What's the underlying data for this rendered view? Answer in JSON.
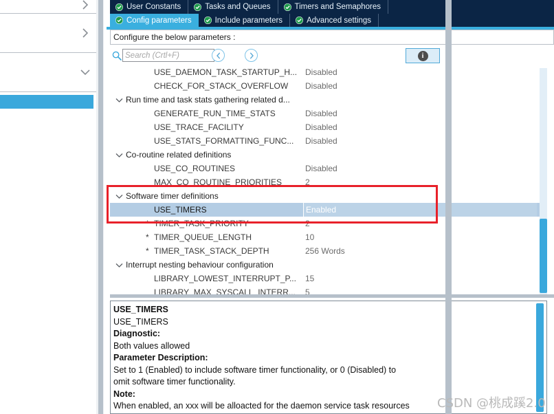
{
  "sidebar": {
    "rows": [
      {
        "chevron": "chevron-right"
      },
      {
        "chevron": "chevron-right"
      },
      {
        "chevron": "chevron-down"
      }
    ],
    "highlight_color": "#3aa8dc"
  },
  "tabs": {
    "row1": [
      {
        "label": "User Constants",
        "icon": "check-circle-icon",
        "active": false
      },
      {
        "label": "Tasks and Queues",
        "icon": "check-circle-icon",
        "active": false
      },
      {
        "label": "Timers and Semaphores",
        "icon": "check-circle-icon",
        "active": false
      }
    ],
    "row2": [
      {
        "label": "Config parameters",
        "icon": "check-circle-icon",
        "active": true
      },
      {
        "label": "Include parameters",
        "icon": "check-circle-icon",
        "active": false
      },
      {
        "label": "Advanced settings",
        "icon": "check-circle-icon",
        "active": false
      }
    ],
    "active_color": "#3aafdf",
    "inactive_color": "#0b2545"
  },
  "config_bar": {
    "label": "Configure the below parameters :"
  },
  "toolbar": {
    "search_placeholder": "Search (Crtl+F)",
    "search_value": "",
    "back_label": "‹",
    "forward_label": "›",
    "info_label": "i"
  },
  "tree": {
    "rows": [
      {
        "type": "param",
        "star": "",
        "name": "USE_DAEMON_TASK_STARTUP_H...",
        "value": "Disabled",
        "selected": false
      },
      {
        "type": "param",
        "star": "",
        "name": "CHECK_FOR_STACK_OVERFLOW",
        "value": "Disabled",
        "selected": false
      },
      {
        "type": "group",
        "label": "Run time and task stats gathering related d...",
        "chevron": "chevron-down"
      },
      {
        "type": "param",
        "star": "",
        "name": "GENERATE_RUN_TIME_STATS",
        "value": "Disabled",
        "selected": false
      },
      {
        "type": "param",
        "star": "",
        "name": "USE_TRACE_FACILITY",
        "value": "Disabled",
        "selected": false
      },
      {
        "type": "param",
        "star": "",
        "name": "USE_STATS_FORMATTING_FUNC...",
        "value": "Disabled",
        "selected": false
      },
      {
        "type": "group",
        "label": "Co-routine related definitions",
        "chevron": "chevron-down"
      },
      {
        "type": "param",
        "star": "",
        "name": "USE_CO_ROUTINES",
        "value": "Disabled",
        "selected": false
      },
      {
        "type": "param",
        "star": "",
        "name": "MAX_CO_ROUTINE_PRIORITIES",
        "value": "2",
        "selected": false
      },
      {
        "type": "group",
        "label": "Software timer definitions",
        "chevron": "chevron-down"
      },
      {
        "type": "param",
        "star": "",
        "name": "USE_TIMERS",
        "value": "Enabled",
        "selected": true
      },
      {
        "type": "param",
        "star": "*",
        "name": "TIMER_TASK_PRIORITY",
        "value": "2",
        "selected": false
      },
      {
        "type": "param",
        "star": "*",
        "name": "TIMER_QUEUE_LENGTH",
        "value": "10",
        "selected": false
      },
      {
        "type": "param",
        "star": "*",
        "name": "TIMER_TASK_STACK_DEPTH",
        "value": "256 Words",
        "selected": false
      },
      {
        "type": "group",
        "label": "Interrupt nesting behaviour configuration",
        "chevron": "chevron-down"
      },
      {
        "type": "param",
        "star": "",
        "name": "LIBRARY_LOWEST_INTERRUPT_P...",
        "value": "15",
        "selected": false
      },
      {
        "type": "param",
        "star": "",
        "name": "LIBRARY_MAX_SYSCALL_INTERR...",
        "value": "5",
        "selected": false
      }
    ],
    "selected_row_color": "#b4cde4"
  },
  "description": {
    "lines": [
      {
        "text": "USE_TIMERS",
        "bold": true
      },
      {
        "text": "USE_TIMERS",
        "bold": false
      },
      {
        "text": "Diagnostic:",
        "bold": true
      },
      {
        "text": "Both values allowed",
        "bold": false
      },
      {
        "text": "Parameter Description:",
        "bold": true
      },
      {
        "text": "Set to 1 (Enabled) to include software timer functionality, or 0 (Disabled) to",
        "bold": false
      },
      {
        "text": "omit software timer functionality.",
        "bold": false
      },
      {
        "text": "Note:",
        "bold": true
      },
      {
        "text": "When enabled, an xxx will be alloacted for the daemon service task resources",
        "bold": false
      }
    ]
  },
  "watermark": {
    "text": "CSDN @桃成蹊2.0"
  }
}
